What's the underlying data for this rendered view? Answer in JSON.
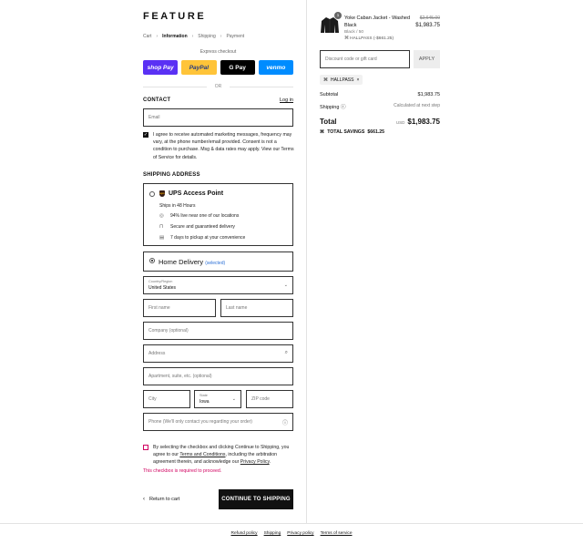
{
  "brand": "FEATURE",
  "breadcrumb": {
    "items": [
      "Cart",
      "Information",
      "Shipping",
      "Payment"
    ],
    "separator": "›"
  },
  "express": {
    "label": "Express checkout",
    "buttons": [
      "shop Pay",
      "PayPal",
      "G Pay",
      "venmo"
    ],
    "or": "OR"
  },
  "contact": {
    "heading": "CONTACT",
    "login": "Log in",
    "email_placeholder": "Email",
    "marketing_text": "I agree to receive automated marketing messages, frequency may vary, at the phone number/email provided. Consent is not a condition to purchase. Msg & data rates may apply. View our Terms of Service for details."
  },
  "shipping": {
    "heading": "SHIPPING ADDRESS",
    "ups": {
      "title": "UPS Access Point",
      "subtitle": "Ships in 48 Hours",
      "features": [
        "94% live near one of our locations",
        "Secure and guaranteed delivery",
        "7 days to pickup at your convenience"
      ]
    },
    "home": {
      "title": "Home Delivery",
      "selected": "(selected)"
    },
    "country": {
      "label": "Country/Region",
      "value": "United States"
    },
    "first_name": "First name",
    "last_name": "Last name",
    "company": "Company (optional)",
    "address": "Address",
    "apartment": "Apartment, suite, etc. (optional)",
    "city": "City",
    "state": {
      "label": "State",
      "value": "Iowa"
    },
    "zip": "ZIP code",
    "phone": "Phone (We'll only contact you regarding your order)"
  },
  "terms": {
    "text_1": "By selecting the checkbox and clicking Continue to Shipping, you agree to our ",
    "link_terms": "Terms and Conditions",
    "text_2": ", including the arbitration agreement therein, and acknowledge our ",
    "link_privacy": "Privacy Policy",
    "text_3": ".",
    "error": "This checkbox is required to proceed."
  },
  "actions": {
    "back": "Return to cart",
    "continue": "CONTINUE TO SHIPPING"
  },
  "footer": [
    "Refund policy",
    "Shipping",
    "Privacy policy",
    "Terms of service"
  ],
  "summary": {
    "product": {
      "quantity": "1",
      "name": "Yoke Caban Jacket - Washed Black",
      "variant": "Black / 50",
      "discount_code": "HALLPASS (-$661.25)",
      "old_price": "$2,645.00",
      "price": "$1,983.75"
    },
    "discount_placeholder": "Discount code or gift card",
    "apply": "APPLY",
    "applied_code": "HALLPASS",
    "subtotal_label": "Subtotal",
    "subtotal": "$1,983.75",
    "shipping_label": "Shipping",
    "shipping_value": "Calculated at next step",
    "total_label": "Total",
    "currency": "USD",
    "total": "$1,983.75",
    "savings_label": "TOTAL SAVINGS",
    "savings": "$661.25"
  },
  "colors": {
    "accent": "#111111",
    "error": "#d10060",
    "selected_link": "#2a6fd6",
    "shop_pay": "#5a31f4",
    "paypal": "#ffc439",
    "venmo": "#008cff"
  }
}
